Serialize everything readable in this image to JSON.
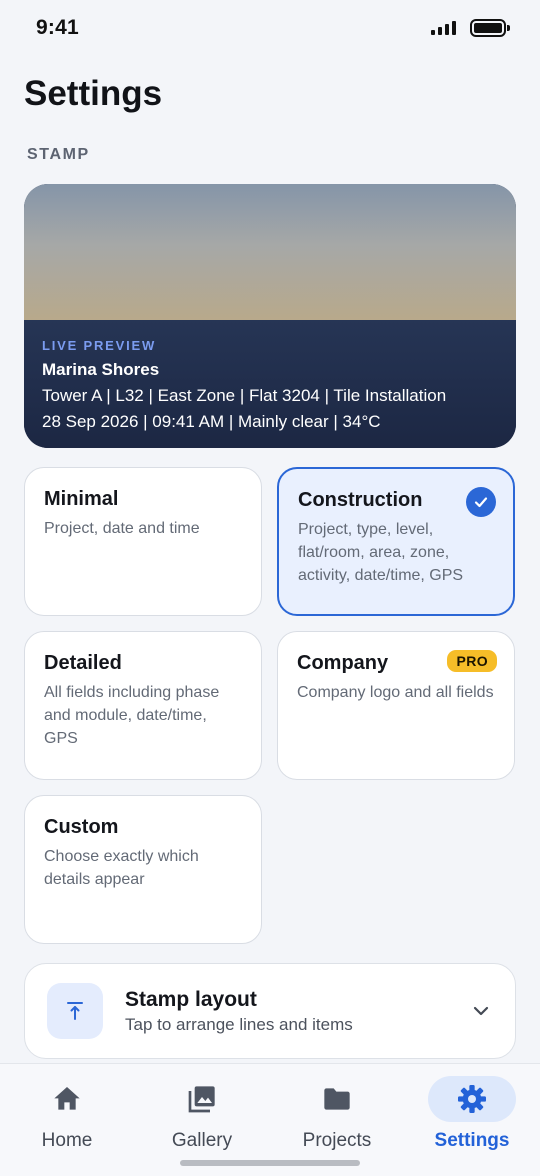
{
  "status_bar": {
    "time": "9:41"
  },
  "page": {
    "title": "Settings",
    "section_label": "STAMP"
  },
  "preview": {
    "tag": "LIVE PREVIEW",
    "project": "Marina Shores",
    "line1": "Tower A | L32 | East Zone | Flat 3204 | Tile Installation",
    "line2": "28 Sep 2026 | 09:41 AM | Mainly clear | 34°C"
  },
  "stamp_options": [
    {
      "title": "Minimal",
      "description": "Project, date and time",
      "selected": false
    },
    {
      "title": "Construction",
      "description": "Project, type, level, flat/room, area, zone, activity, date/time, GPS",
      "selected": true
    },
    {
      "title": "Detailed",
      "description": "All fields including phase and module, date/time, GPS",
      "selected": false
    },
    {
      "title": "Company",
      "description": "Company logo and all fields",
      "badge": "PRO",
      "selected": false
    },
    {
      "title": "Custom",
      "description": "Choose exactly which details appear",
      "selected": false
    }
  ],
  "layout": {
    "title": "Stamp layout",
    "subtitle": "Tap to arrange lines and items",
    "icon": "align-top-icon"
  },
  "nav": [
    {
      "label": "Home",
      "icon": "home-icon",
      "active": false
    },
    {
      "label": "Gallery",
      "icon": "gallery-icon",
      "active": false
    },
    {
      "label": "Projects",
      "icon": "folder-icon",
      "active": false
    },
    {
      "label": "Settings",
      "icon": "gear-icon",
      "active": true
    }
  ],
  "colors": {
    "accent": "#2b67d6",
    "selected_card_bg": "#e9f0fe",
    "pro_badge": "#f6bd28",
    "preview_panel": "#1e2a45"
  }
}
